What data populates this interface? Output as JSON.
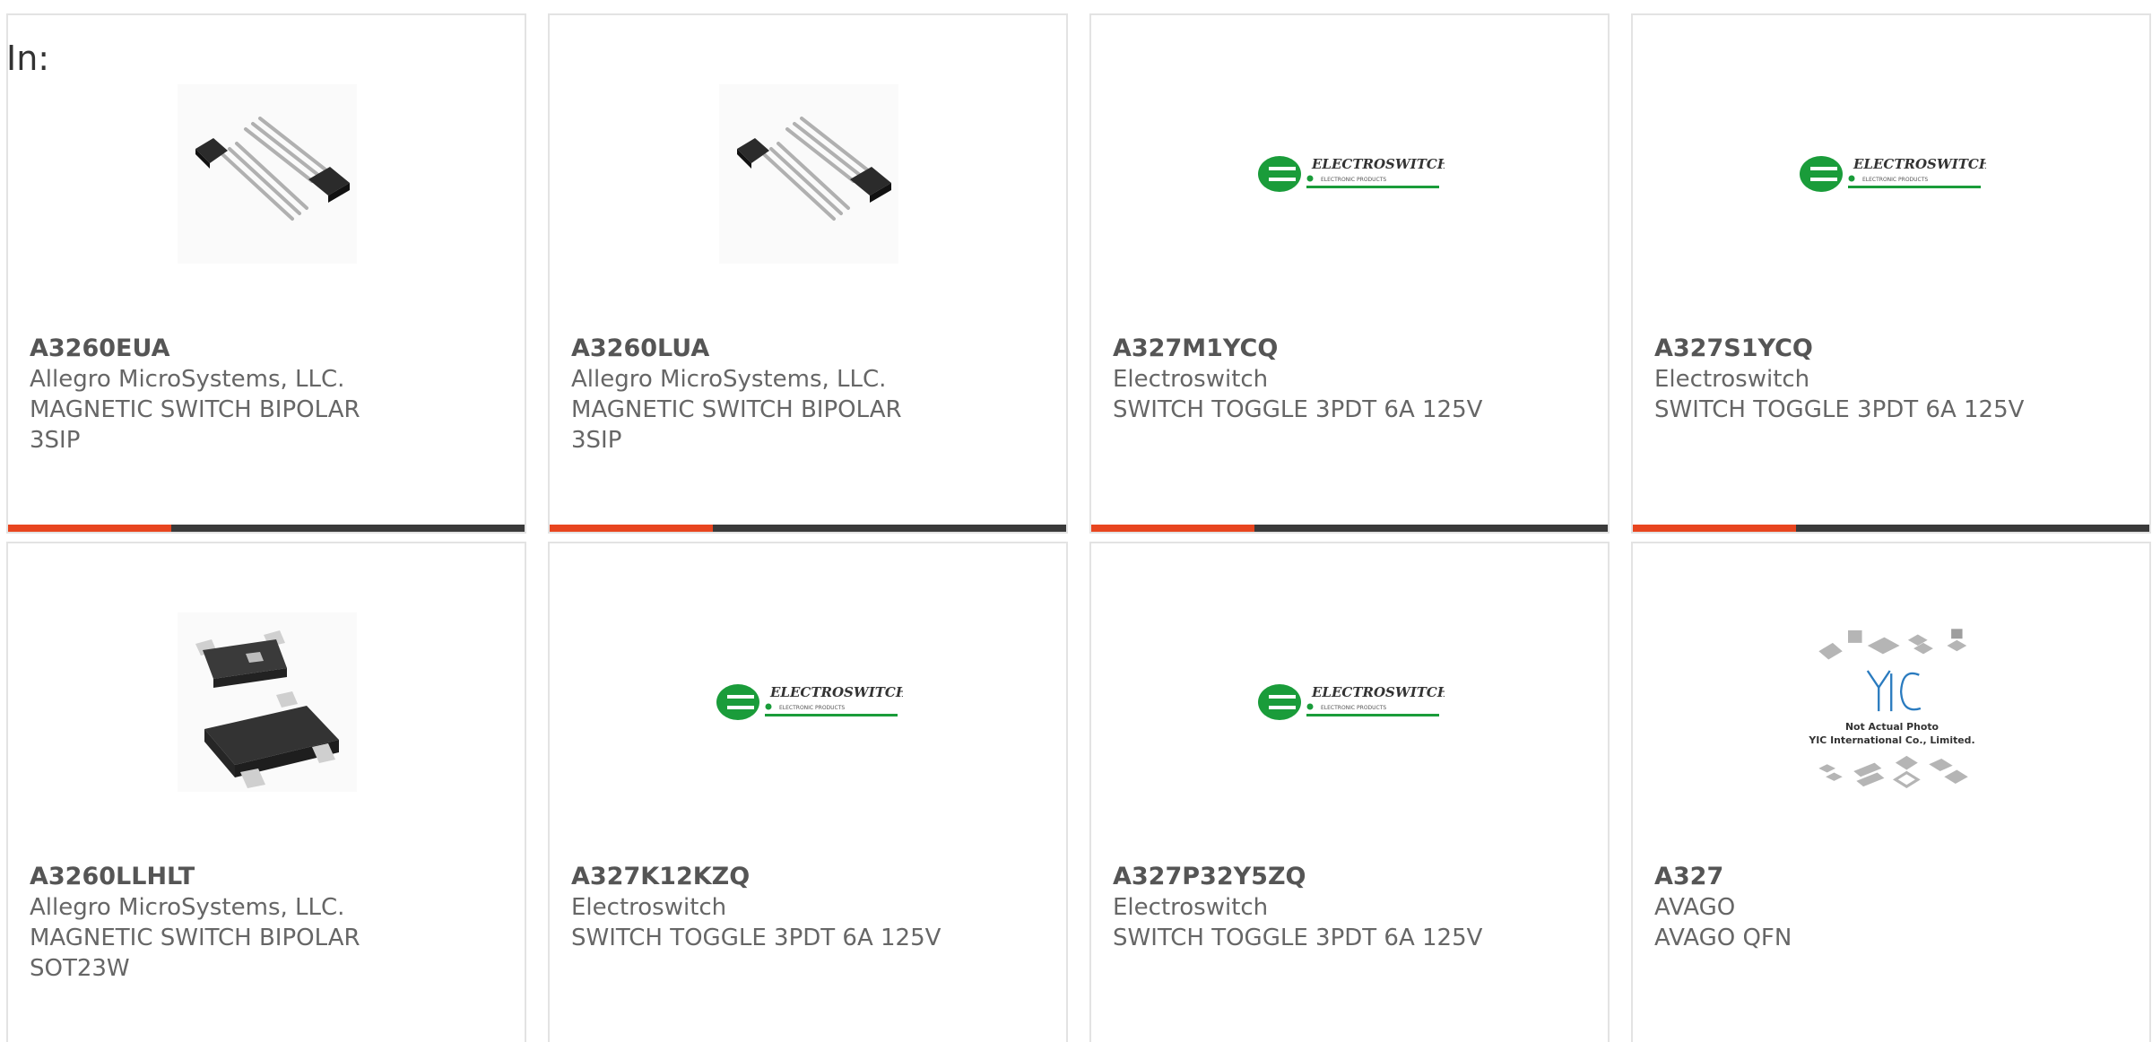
{
  "header": {
    "in_label": "In:"
  },
  "colors": {
    "accent": "#e8451f",
    "bar": "#3a3a3a",
    "text": "#666666",
    "brand_green": "#1a9c3a"
  },
  "products": [
    {
      "part": "A3260EUA",
      "maker": "Allegro MicroSystems, LLC.",
      "desc1": "MAGNETIC SWITCH BIPOLAR",
      "desc2": "3SIP",
      "image": "sip-transistor-photo"
    },
    {
      "part": "A3260LUA",
      "maker": "Allegro MicroSystems, LLC.",
      "desc1": "MAGNETIC SWITCH BIPOLAR",
      "desc2": "3SIP",
      "image": "sip-transistor-photo"
    },
    {
      "part": "A327M1YCQ",
      "maker": "Electroswitch",
      "desc1": "SWITCH TOGGLE 3PDT 6A 125V",
      "desc2": "",
      "image": "electroswitch-logo"
    },
    {
      "part": "A327S1YCQ",
      "maker": "Electroswitch",
      "desc1": "SWITCH TOGGLE 3PDT 6A 125V",
      "desc2": "",
      "image": "electroswitch-logo"
    },
    {
      "part": "A3260LLHLT",
      "maker": "Allegro MicroSystems, LLC.",
      "desc1": "MAGNETIC SWITCH BIPOLAR",
      "desc2": "SOT23W",
      "image": "sot23-package-photo"
    },
    {
      "part": "A327K12KZQ",
      "maker": "Electroswitch",
      "desc1": "SWITCH TOGGLE 3PDT 6A 125V",
      "desc2": "",
      "image": "electroswitch-logo"
    },
    {
      "part": "A327P32Y5ZQ",
      "maker": "Electroswitch",
      "desc1": "SWITCH TOGGLE 3PDT 6A 125V",
      "desc2": "",
      "image": "electroswitch-logo"
    },
    {
      "part": "A327",
      "maker": "AVAGO",
      "desc1": "AVAGO QFN",
      "desc2": "",
      "image": "yic-placeholder"
    }
  ],
  "logos": {
    "electroswitch_name": "ELECTROSWITCH",
    "electroswitch_tag": "ELECTRONIC PRODUCTS",
    "yic_mark": "YIC",
    "yic_line1": "Not Actual Photo",
    "yic_line2": "YIC International Co., Limited."
  }
}
